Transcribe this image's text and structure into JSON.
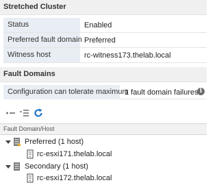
{
  "stretched_cluster": {
    "title": "Stretched Cluster",
    "rows": [
      {
        "label": "Status",
        "value": "Enabled"
      },
      {
        "label": "Preferred fault domain",
        "value": "Preferred"
      },
      {
        "label": "Witness host",
        "value": "rc-witness173.thelab.local"
      }
    ]
  },
  "fault_domains": {
    "title": "Fault Domains",
    "tolerate": {
      "label": "Configuration can tolerate maximum",
      "value": "1 fault domain failures"
    },
    "grid_header": "Fault Domain/Host",
    "tree": [
      {
        "label": "Preferred (1 host)",
        "hosts": [
          "rc-esxi171.thelab.local"
        ]
      },
      {
        "label": "Secondary (1 host)",
        "hosts": [
          "rc-esxi172.thelab.local"
        ]
      }
    ]
  },
  "icons": {
    "add": "add-fault-domain-icon",
    "edit": "edit-list-icon",
    "refresh": "refresh-icon",
    "info": "info-icon",
    "folder_star": "preferred-domain-icon",
    "folder": "secondary-domain-icon",
    "host": "host-icon"
  },
  "colors": {
    "accent": "#1a73c8",
    "label_bg": "#e8eef3",
    "header_bg": "#f0f0f0"
  }
}
